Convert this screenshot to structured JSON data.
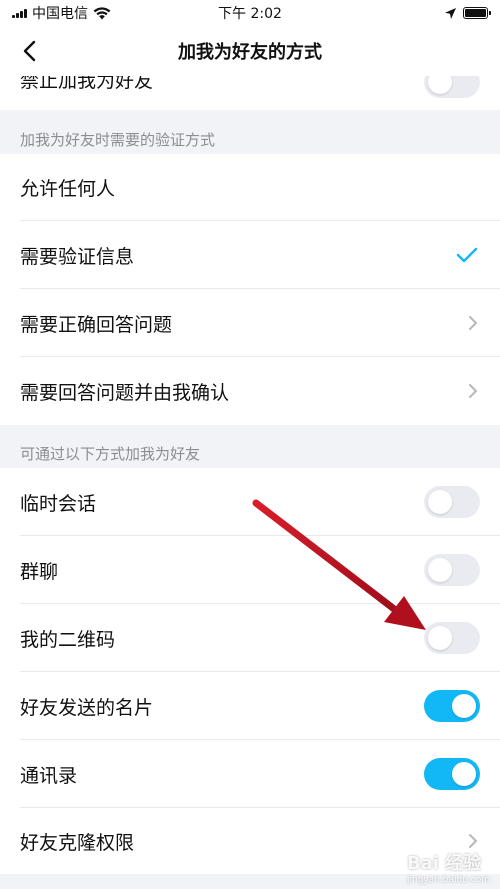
{
  "status_bar": {
    "carrier": "中国电信",
    "time": "下午 2:02",
    "icons": [
      "signal-icon",
      "wifi-icon",
      "location-arrow-icon",
      "battery-icon"
    ]
  },
  "nav": {
    "title": "加我为好友的方式",
    "back_icon": "chevron-left-icon"
  },
  "top_row": {
    "label": "禁止加我为好友",
    "toggle_on": false
  },
  "verification_section": {
    "header": "加我为好友时需要的验证方式",
    "items": [
      {
        "label": "允许任何人",
        "accessory": "none"
      },
      {
        "label": "需要验证信息",
        "accessory": "check-icon"
      },
      {
        "label": "需要正确回答问题",
        "accessory": "chevron-right-icon"
      },
      {
        "label": "需要回答问题并由我确认",
        "accessory": "chevron-right-icon"
      }
    ]
  },
  "methods_section": {
    "header": "可通过以下方式加我为好友",
    "items": [
      {
        "label": "临时会话",
        "toggle_on": false
      },
      {
        "label": "群聊",
        "toggle_on": false
      },
      {
        "label": "我的二维码",
        "toggle_on": false
      },
      {
        "label": "好友发送的名片",
        "toggle_on": true
      },
      {
        "label": "通讯录",
        "toggle_on": true
      },
      {
        "label": "好友克隆权限",
        "accessory": "chevron-right-icon"
      }
    ]
  },
  "annotation": {
    "icon": "red-arrow-icon",
    "color": "#c8102e"
  },
  "colors": {
    "accent": "#12b7f5",
    "check": "#12b7f5",
    "toggle_off": "#e9ebf0",
    "background": "#f2f3f7",
    "section_text": "#8a8d93"
  },
  "watermark": {
    "text": "Bai 经验",
    "sub": "jingyan.baidu.com"
  }
}
